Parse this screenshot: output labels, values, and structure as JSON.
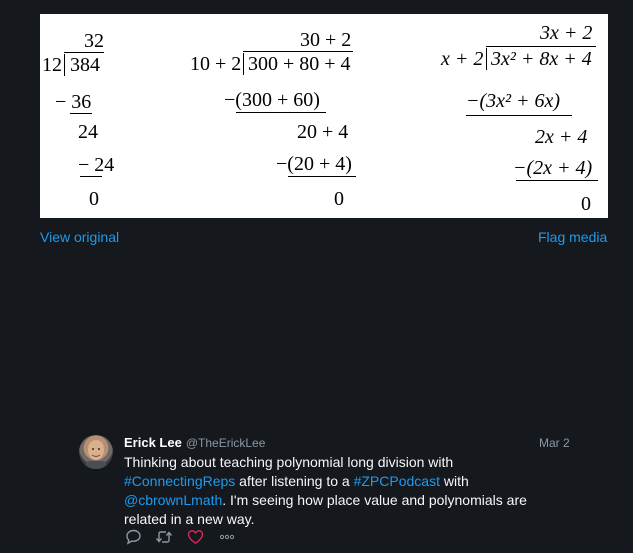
{
  "media": {
    "left": {
      "quotient": "32",
      "divisor": "12",
      "dividend": "384",
      "step1": "− 36",
      "rem1": "24",
      "step2": "− 24",
      "result": "0"
    },
    "middle": {
      "quotient": "30 + 2",
      "divisor": "10 + 2",
      "dividend": "300 + 80 + 4",
      "step1": "−(300 + 60)",
      "rem1": "20 + 4",
      "step2": "−(20 + 4)",
      "result": "0"
    },
    "right": {
      "quotient": "3x + 2",
      "divisor": "x + 2",
      "dividend": "3x² + 8x + 4",
      "step1": "−(3x² + 6x)",
      "rem1": "2x + 4",
      "step2": "−(2x + 4)",
      "result": "0"
    }
  },
  "links": {
    "view_original": "View original",
    "flag_media": "Flag media"
  },
  "tweet": {
    "name": "Erick Lee",
    "handle": "@TheErickLee",
    "date": "Mar 2",
    "text_1": "Thinking about teaching polynomial long division with ",
    "hashtag_1": "#ConnectingReps",
    "text_2": " after listening to a ",
    "hashtag_2": "#ZPCPodcast",
    "text_3": " with ",
    "mention": "@cbrownLmath",
    "text_4": ". I'm seeing how place value and polynomials are related in a new way."
  },
  "icons": {
    "reply": "reply-icon",
    "retweet": "retweet-icon",
    "like": "heart-icon",
    "more": "more-icon"
  },
  "colors": {
    "background": "#15181c",
    "link": "#1d9bf0",
    "like": "#e0245e",
    "muted": "#8b98a5"
  }
}
